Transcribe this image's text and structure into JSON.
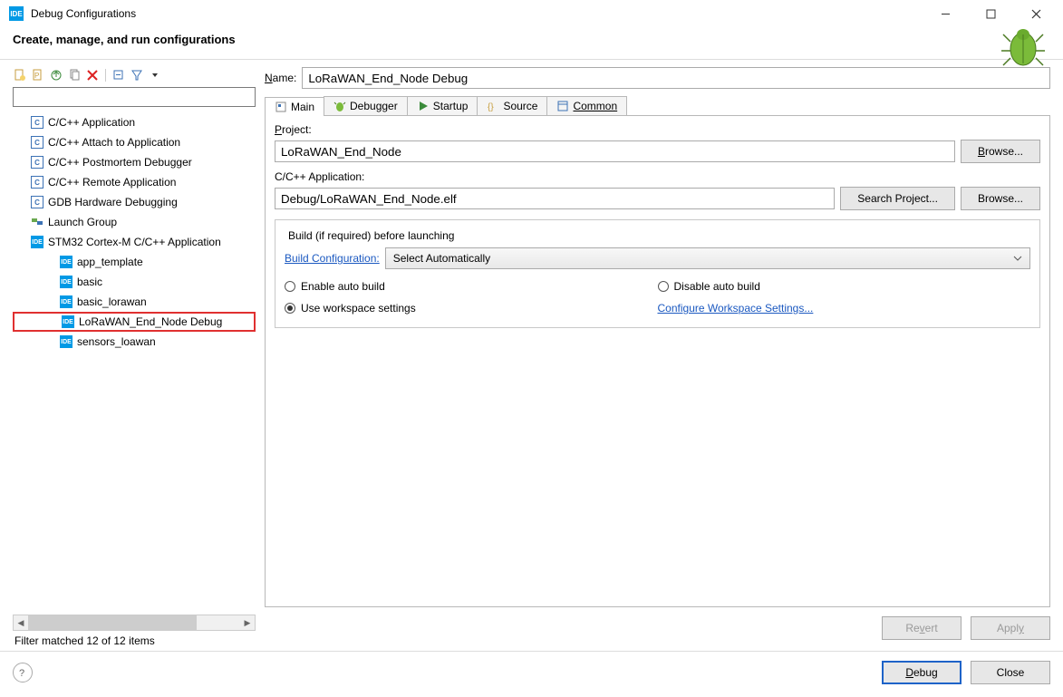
{
  "window": {
    "title": "Debug Configurations"
  },
  "header": {
    "title": "Create, manage, and run configurations"
  },
  "toolbar": {
    "new_config": "new",
    "duplicate": "dup",
    "export": "exp",
    "delete": "del",
    "collapse": "col",
    "filter": "filter"
  },
  "tree_filter": "",
  "tree": {
    "items": [
      {
        "label": "C/C++ Application",
        "icon": "c"
      },
      {
        "label": "C/C++ Attach to Application",
        "icon": "c"
      },
      {
        "label": "C/C++ Postmortem Debugger",
        "icon": "c"
      },
      {
        "label": "C/C++ Remote Application",
        "icon": "c"
      },
      {
        "label": "GDB Hardware Debugging",
        "icon": "c"
      },
      {
        "label": "Launch Group",
        "icon": "lg"
      },
      {
        "label": "STM32 Cortex-M C/C++ Application",
        "icon": "ide",
        "expanded": true,
        "children": [
          {
            "label": "app_template"
          },
          {
            "label": "basic"
          },
          {
            "label": "basic_lorawan"
          },
          {
            "label": "LoRaWAN_End_Node Debug",
            "selected": true
          },
          {
            "label": "sensors_loawan"
          }
        ]
      }
    ]
  },
  "left_status": "Filter matched 12 of 12 items",
  "form": {
    "name_label": "Name:",
    "name_value": "LoRaWAN_End_Node Debug",
    "tabs": [
      "Main",
      "Debugger",
      "Startup",
      "Source",
      "Common"
    ],
    "active_tab": 0,
    "project_label": "Project:",
    "project_value": "LoRaWAN_End_Node",
    "browse_label": "Browse...",
    "cpp_app_label": "C/C++ Application:",
    "cpp_app_value": "Debug/LoRaWAN_End_Node.elf",
    "search_project_label": "Search Project...",
    "group_title": "Build (if required) before launching",
    "build_config_label": "Build Configuration:",
    "build_config_value": "Select Automatically",
    "radio_enable": "Enable auto build",
    "radio_disable": "Disable auto build",
    "radio_workspace": "Use workspace settings",
    "configure_link": "Configure Workspace Settings..."
  },
  "buttons": {
    "revert": "Revert",
    "apply": "Apply",
    "debug": "Debug",
    "close": "Close"
  }
}
